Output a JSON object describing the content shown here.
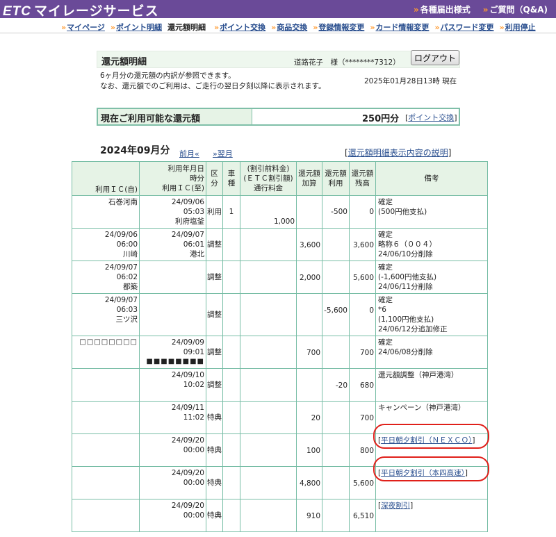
{
  "brand": {
    "logo": "ETC",
    "title": "マイレージサービス"
  },
  "top_links": [
    "各種届出様式",
    "ご質問（Q&A)"
  ],
  "nav": [
    {
      "label": "マイページ",
      "current": false
    },
    {
      "label": "ポイント明細",
      "current": false
    },
    {
      "label": "還元額明細",
      "current": true
    },
    {
      "label": "ポイント交換",
      "current": false
    },
    {
      "label": "商品交換",
      "current": false
    },
    {
      "label": "登録情報変更",
      "current": false
    },
    {
      "label": "カード情報変更",
      "current": false
    },
    {
      "label": "パスワード変更",
      "current": false
    },
    {
      "label": "利用停止",
      "current": false
    }
  ],
  "header": {
    "title": "還元額明細",
    "user": "道路花子　様（********7312）",
    "logout": "ログアウト",
    "desc1": "6ヶ月分の還元額の内訳が参照できます。",
    "desc2": "なお、還元額でのご利用は、ご走行の翌日夕刻以降に表示されます。",
    "as_of": "2025年01月28日13時 現在"
  },
  "available": {
    "label": "現在ご利用可能な還元額",
    "amount": "250円分",
    "link": "ポイント交換"
  },
  "period": {
    "month": "2024年09月分",
    "prev": "前月«",
    "next": "»翌月",
    "explain": "還元額明細表示内容の説明"
  },
  "table": {
    "headers": {
      "date_line1": "利用年月日",
      "date_line2": "時分",
      "ic_in": "利用ＩＣ(自)",
      "ic_out": "利用ＩＣ(至)",
      "category": "区分",
      "vehicle": "車種",
      "fee1": "(割引前料金)",
      "fee2": "(ＥＴＣ割引額)",
      "fee3": "通行料金",
      "add1": "還元額",
      "add2": "加算",
      "use1": "還元額",
      "use2": "利用",
      "bal1": "還元額",
      "bal2": "残高",
      "remarks": "備考"
    },
    "rows": [
      {
        "in_date": "",
        "in_time": "",
        "in_ic": "石巻河南",
        "out_date": "24/09/06",
        "out_time": "05:03",
        "out_ic": "利府塩釜",
        "category": "利用",
        "vehicle": "1",
        "fee": "1,000",
        "add": "",
        "use": "-500",
        "balance": "0",
        "notes": [
          "確定",
          "(500円他支払)"
        ],
        "note_link": ""
      },
      {
        "in_date": "24/09/06",
        "in_time": "06:00",
        "in_ic": "川崎",
        "out_date": "24/09/07",
        "out_time": "06:01",
        "out_ic": "港北",
        "category": "調整",
        "vehicle": "",
        "fee": "",
        "add": "3,600",
        "use": "",
        "balance": "3,600",
        "notes": [
          "確定",
          "略称６（００４）",
          "24/06/10分削除"
        ],
        "note_link": ""
      },
      {
        "in_date": "24/09/07",
        "in_time": "06:02",
        "in_ic": "都築",
        "out_date": "",
        "out_time": "",
        "out_ic": "",
        "category": "調整",
        "vehicle": "",
        "fee": "",
        "add": "2,000",
        "use": "",
        "balance": "5,600",
        "notes": [
          "確定",
          "(-1,600円他支払)",
          "24/06/11分削除"
        ],
        "note_link": ""
      },
      {
        "in_date": "24/09/07",
        "in_time": "06:03",
        "in_ic": "三ツ沢",
        "out_date": "",
        "out_time": "",
        "out_ic": "",
        "category": "調整",
        "vehicle": "",
        "fee": "",
        "add": "",
        "use": "-5,600",
        "balance": "0",
        "notes": [
          "確定",
          "*6",
          "(1,100円他支払)",
          "24/06/12分追加修正"
        ],
        "note_link": ""
      },
      {
        "in_date": "",
        "in_time": "",
        "in_ic": "□□□□□□□□",
        "out_date": "24/09/09",
        "out_time": "09:01",
        "out_ic": "■■■■■■■■",
        "category": "調整",
        "vehicle": "",
        "fee": "",
        "add": "700",
        "use": "",
        "balance": "700",
        "notes": [
          "確定",
          "24/06/08分削除"
        ],
        "note_link": ""
      },
      {
        "in_date": "",
        "in_time": "",
        "in_ic": "",
        "out_date": "24/09/10",
        "out_time": "10:02",
        "out_ic": "",
        "category": "調整",
        "vehicle": "",
        "fee": "",
        "add": "",
        "use": "-20",
        "balance": "680",
        "notes": [
          "還元額調整（神戸港湾）"
        ],
        "note_link": ""
      },
      {
        "in_date": "",
        "in_time": "",
        "in_ic": "",
        "out_date": "24/09/11",
        "out_time": "11:02",
        "out_ic": "",
        "category": "特典",
        "vehicle": "",
        "fee": "",
        "add": "20",
        "use": "",
        "balance": "700",
        "notes": [
          "キャンペーン（神戸港湾）"
        ],
        "note_link": ""
      },
      {
        "in_date": "",
        "in_time": "",
        "in_ic": "",
        "out_date": "24/09/20",
        "out_time": "00:00",
        "out_ic": "",
        "category": "特典",
        "vehicle": "",
        "fee": "",
        "add": "100",
        "use": "",
        "balance": "800",
        "notes": [],
        "note_link": "平日朝夕割引（ＮＥＸＣＯ）"
      },
      {
        "in_date": "",
        "in_time": "",
        "in_ic": "",
        "out_date": "24/09/20",
        "out_time": "00:00",
        "out_ic": "",
        "category": "特典",
        "vehicle": "",
        "fee": "",
        "add": "4,800",
        "use": "",
        "balance": "5,600",
        "notes": [],
        "note_link": "平日朝夕割引（本四高速）"
      },
      {
        "in_date": "",
        "in_time": "",
        "in_ic": "",
        "out_date": "24/09/20",
        "out_time": "00:00",
        "out_ic": "",
        "category": "特典",
        "vehicle": "",
        "fee": "",
        "add": "910",
        "use": "",
        "balance": "6,510",
        "notes": [],
        "note_link": "深夜割引"
      }
    ]
  },
  "colors": {
    "header_bar": "#6a4a98",
    "accent_orange": "#ff9a30",
    "table_border": "#77bda5",
    "header_bg": "#e6f3e6",
    "highlight_circle": "#e0201a",
    "link": "#2a4f8f"
  }
}
